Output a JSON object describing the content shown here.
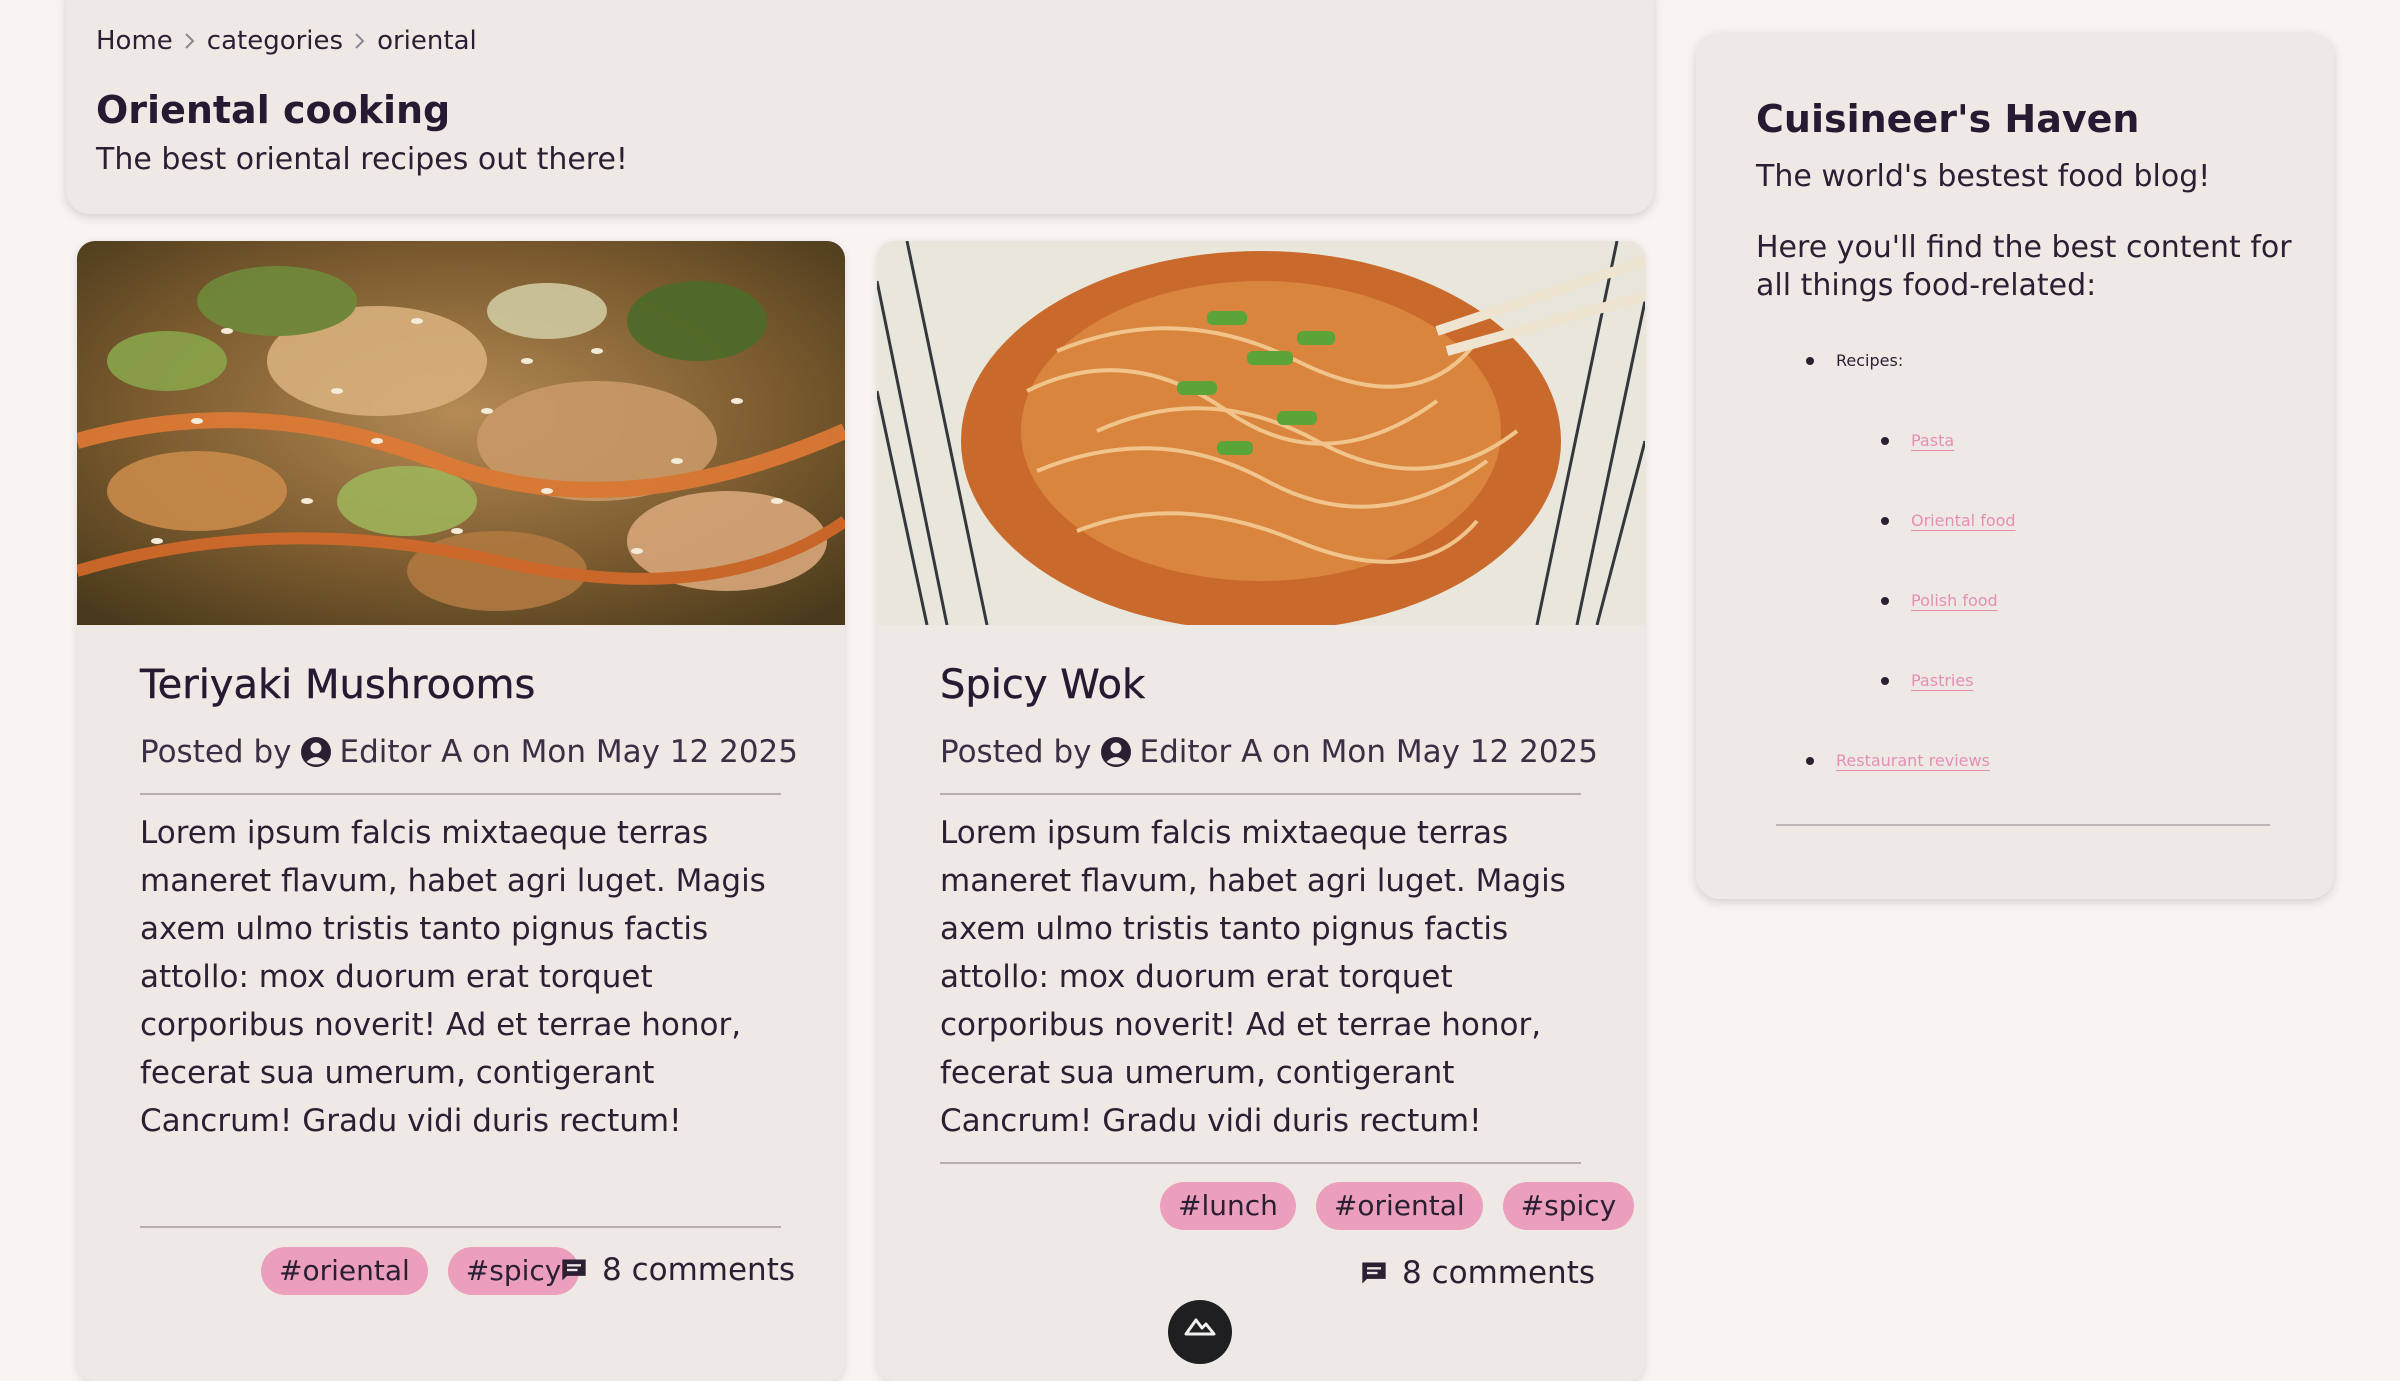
{
  "breadcrumb": [
    "Home",
    "categories",
    "oriental"
  ],
  "page_title": "Oriental cooking",
  "page_subtitle": "The best oriental recipes out there!",
  "posts": [
    {
      "title": "Teriyaki Mushrooms",
      "posted_by": "Posted by",
      "author": "Editor A",
      "date_text": "on Mon May 12 2025",
      "excerpt": "Lorem ipsum falcis mixtaeque terras maneret flavum, habet agri luget. Magis axem ulmo tristis tanto pignus factis attollo: mox duorum erat torquet corporibus noverit! Ad et terrae honor, fecerat sua umerum, contigerant Cancrum! Gradu vidi duris rectum!",
      "tags": [
        "#oriental",
        "#spicy"
      ],
      "comments": "8 comments",
      "image_icon": "stir-fry-photo"
    },
    {
      "title": "Spicy Wok",
      "posted_by": "Posted by",
      "author": "Editor A",
      "date_text": "on Mon May 12 2025",
      "excerpt": "Lorem ipsum falcis mixtaeque terras maneret flavum, habet agri luget. Magis axem ulmo tristis tanto pignus factis attollo: mox duorum erat torquet corporibus noverit! Ad et terrae honor, fecerat sua umerum, contigerant Cancrum! Gradu vidi duris rectum!",
      "tags": [
        "#lunch",
        "#oriental",
        "#spicy"
      ],
      "comments": "8 comments",
      "image_icon": "noodle-bowl-photo"
    }
  ],
  "sidebar": {
    "title": "Cuisineer's Haven",
    "tagline": "The world's bestest food blog!",
    "intro": "Here you'll find the best content for all things food-related:",
    "recipes_label": "Recipes:",
    "recipe_links": [
      "Pasta",
      "Oriental food",
      "Polish food",
      "Pastries"
    ],
    "reviews_link": "Restaurant reviews"
  },
  "colors": {
    "background": "#f8f4f1",
    "card": "#efe9e6",
    "tag": "#ec9fbd",
    "link": "#e58fb4",
    "text": "#2a1f33"
  }
}
